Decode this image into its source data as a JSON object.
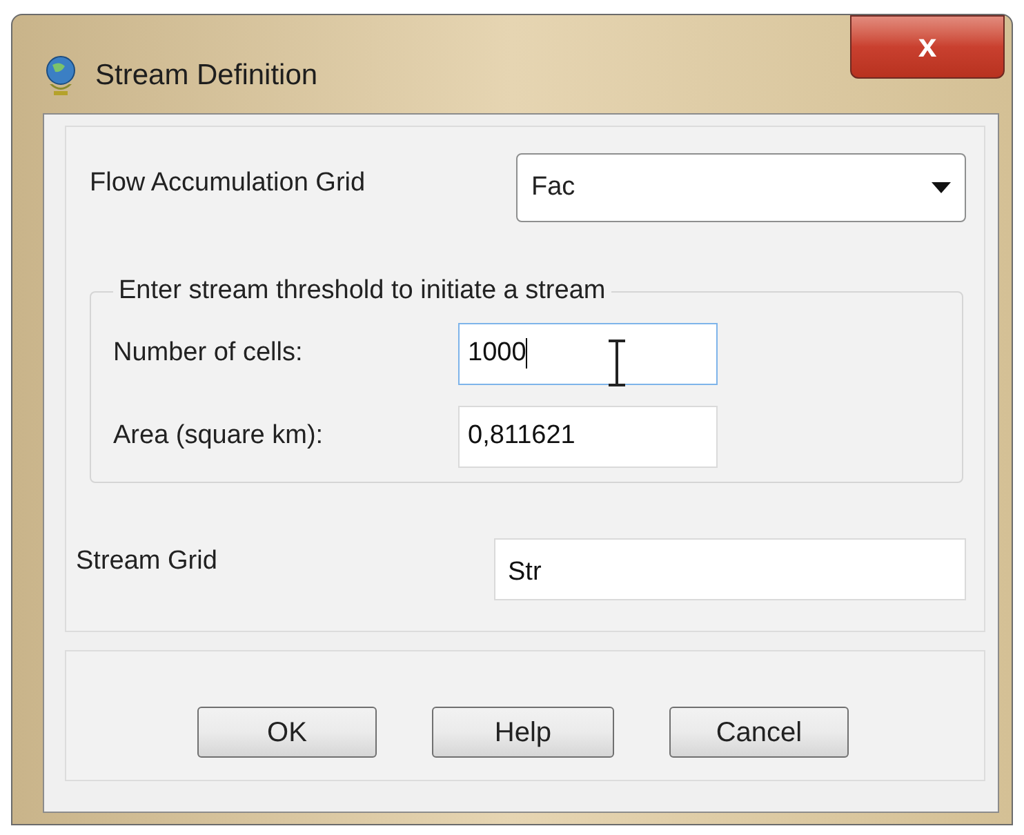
{
  "window": {
    "title": "Stream Definition",
    "close": "x"
  },
  "flow_accumulation_grid": {
    "label": "Flow Accumulation Grid",
    "value": "Fac"
  },
  "threshold_group": {
    "title": "Enter stream threshold to initiate a stream",
    "fields": [
      {
        "label": "Number of cells:",
        "value": "1000",
        "focused": true
      },
      {
        "label": "Area (square km):",
        "value": "0,811621",
        "focused": false
      }
    ]
  },
  "stream_grid": {
    "label": "Stream Grid",
    "value": "Str"
  },
  "buttons": [
    "OK",
    "Help",
    "Cancel"
  ]
}
